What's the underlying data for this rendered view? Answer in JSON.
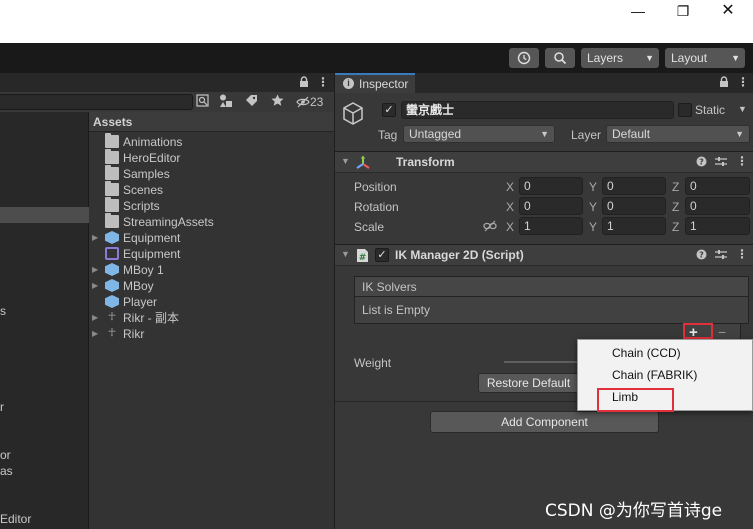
{
  "window": {
    "minimize": "—",
    "restore": "❐",
    "close": "✕"
  },
  "toolbar": {
    "layers_label": "Layers",
    "layout_label": "Layout",
    "history_icon": "history-icon",
    "search_icon": "search-icon"
  },
  "hierarchy": {
    "visible_fragments": [
      "s",
      "r",
      "or",
      "as",
      "Editor"
    ]
  },
  "project": {
    "hidden_count": "23",
    "assets_header": "Assets",
    "items": [
      {
        "label": "Animations",
        "icon": "folder-icon",
        "expandable": false
      },
      {
        "label": "HeroEditor",
        "icon": "folder-icon",
        "expandable": false
      },
      {
        "label": "Samples",
        "icon": "folder-icon",
        "expandable": false
      },
      {
        "label": "Scenes",
        "icon": "folder-icon",
        "expandable": false
      },
      {
        "label": "Scripts",
        "icon": "folder-icon",
        "expandable": false
      },
      {
        "label": "StreamingAssets",
        "icon": "folder-icon",
        "expandable": false
      },
      {
        "label": "Equipment",
        "icon": "prefab-icon",
        "expandable": true
      },
      {
        "label": "Equipment",
        "icon": "sprite-icon",
        "expandable": false
      },
      {
        "label": "MBoy 1",
        "icon": "prefab-icon",
        "expandable": true
      },
      {
        "label": "MBoy",
        "icon": "prefab-icon",
        "expandable": true
      },
      {
        "label": "Player",
        "icon": "prefab-icon",
        "expandable": false
      },
      {
        "label": "Rikr - 副本",
        "icon": "character-icon",
        "expandable": true
      },
      {
        "label": "Rikr",
        "icon": "character-icon",
        "expandable": true
      }
    ]
  },
  "inspector": {
    "tab_label": "Inspector",
    "object_name": "蠻京戲士",
    "static_label": "Static",
    "tag_label": "Tag",
    "tag_value": "Untagged",
    "layer_label": "Layer",
    "layer_value": "Default",
    "transform": {
      "title": "Transform",
      "rows": [
        {
          "label": "Position",
          "x": "0",
          "y": "0",
          "z": "0"
        },
        {
          "label": "Rotation",
          "x": "0",
          "y": "0",
          "z": "0"
        },
        {
          "label": "Scale",
          "x": "1",
          "y": "1",
          "z": "1"
        }
      ],
      "axis_x": "X",
      "axis_y": "Y",
      "axis_z": "Z"
    },
    "ik_manager": {
      "title": "IK Manager 2D (Script)",
      "solvers_header": "IK Solvers",
      "list_empty": "List is Empty",
      "plus": "+",
      "minus": "−",
      "weight_label": "Weight",
      "restore_button": "Restore Default"
    },
    "add_component": "Add Component"
  },
  "popup_menu": {
    "items": [
      "Chain (CCD)",
      "Chain (FABRIK)",
      "Limb"
    ]
  },
  "highlight_color": "#e0303a",
  "watermark": "CSDN @为你写首诗ge"
}
